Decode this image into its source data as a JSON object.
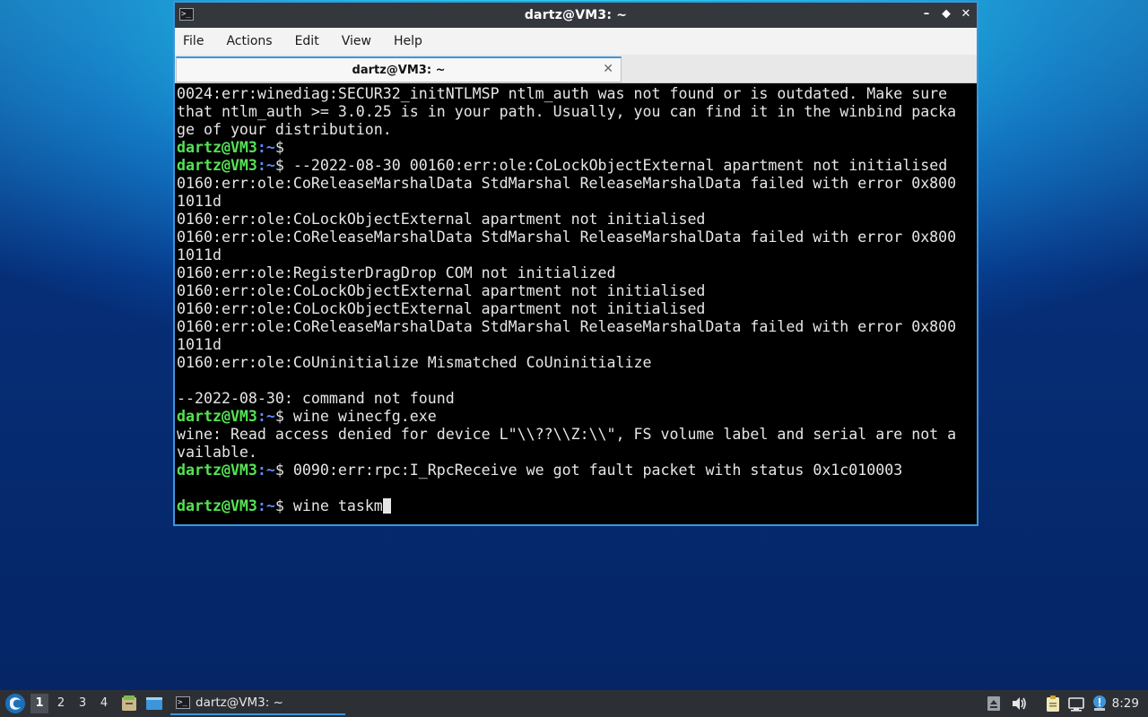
{
  "window": {
    "title": "dartz@VM3: ~",
    "controls": {
      "minimize": "–",
      "maximize": "⬥",
      "close": "✕"
    }
  },
  "menu": [
    "File",
    "Actions",
    "Edit",
    "View",
    "Help"
  ],
  "tab": {
    "label": "dartz@VM3: ~",
    "close": "✕"
  },
  "terminal": {
    "prompt_user": "dartz@VM3",
    "prompt_path": ":~",
    "prompt_symbol": "$ ",
    "lines": [
      {
        "prompt": false,
        "text": "0024:err:winediag:SECUR32_initNTLMSP ntlm_auth was not found or is outdated. Make sure"
      },
      {
        "prompt": false,
        "text": "that ntlm_auth >= 3.0.25 is in your path. Usually, you can find it in the winbind packa"
      },
      {
        "prompt": false,
        "text": "ge of your distribution."
      },
      {
        "prompt": true,
        "text": ""
      },
      {
        "prompt": true,
        "text": "--2022-08-30 00160:err:ole:CoLockObjectExternal apartment not initialised"
      },
      {
        "prompt": false,
        "text": "0160:err:ole:CoReleaseMarshalData StdMarshal ReleaseMarshalData failed with error 0x800"
      },
      {
        "prompt": false,
        "text": "1011d"
      },
      {
        "prompt": false,
        "text": "0160:err:ole:CoLockObjectExternal apartment not initialised"
      },
      {
        "prompt": false,
        "text": "0160:err:ole:CoReleaseMarshalData StdMarshal ReleaseMarshalData failed with error 0x800"
      },
      {
        "prompt": false,
        "text": "1011d"
      },
      {
        "prompt": false,
        "text": "0160:err:ole:RegisterDragDrop COM not initialized"
      },
      {
        "prompt": false,
        "text": "0160:err:ole:CoLockObjectExternal apartment not initialised"
      },
      {
        "prompt": false,
        "text": "0160:err:ole:CoLockObjectExternal apartment not initialised"
      },
      {
        "prompt": false,
        "text": "0160:err:ole:CoReleaseMarshalData StdMarshal ReleaseMarshalData failed with error 0x800"
      },
      {
        "prompt": false,
        "text": "1011d"
      },
      {
        "prompt": false,
        "text": "0160:err:ole:CoUninitialize Mismatched CoUninitialize"
      },
      {
        "prompt": false,
        "text": ""
      },
      {
        "prompt": false,
        "text": "--2022-08-30: command not found"
      },
      {
        "prompt": true,
        "text": "wine winecfg.exe"
      },
      {
        "prompt": false,
        "text": "wine: Read access denied for device L\"\\\\??\\\\Z:\\\\\", FS volume label and serial are not a"
      },
      {
        "prompt": false,
        "text": "vailable."
      },
      {
        "prompt": true,
        "text": "0090:err:rpc:I_RpcReceive we got fault packet with status 0x1c010003"
      },
      {
        "prompt": false,
        "text": ""
      },
      {
        "prompt": true,
        "text": "wine taskm",
        "cursor": true
      }
    ]
  },
  "taskbar": {
    "workspaces": [
      "1",
      "2",
      "3",
      "4"
    ],
    "active_workspace": "1",
    "task_label": "dartz@VM3: ~",
    "clock": "8:29",
    "icons": {
      "start": "lxqt-start-icon",
      "file_manager": "file-manager-icon",
      "desktop": "show-desktop-icon",
      "task": "terminal-icon",
      "tray": [
        "removable-media-icon",
        "volume-icon",
        "clipboard-icon",
        "network-icon",
        "update-notifier-icon"
      ]
    }
  },
  "colors": {
    "prompt_user": "#55e255",
    "prompt_path": "#5c8cff",
    "accent": "#3d95dc"
  }
}
